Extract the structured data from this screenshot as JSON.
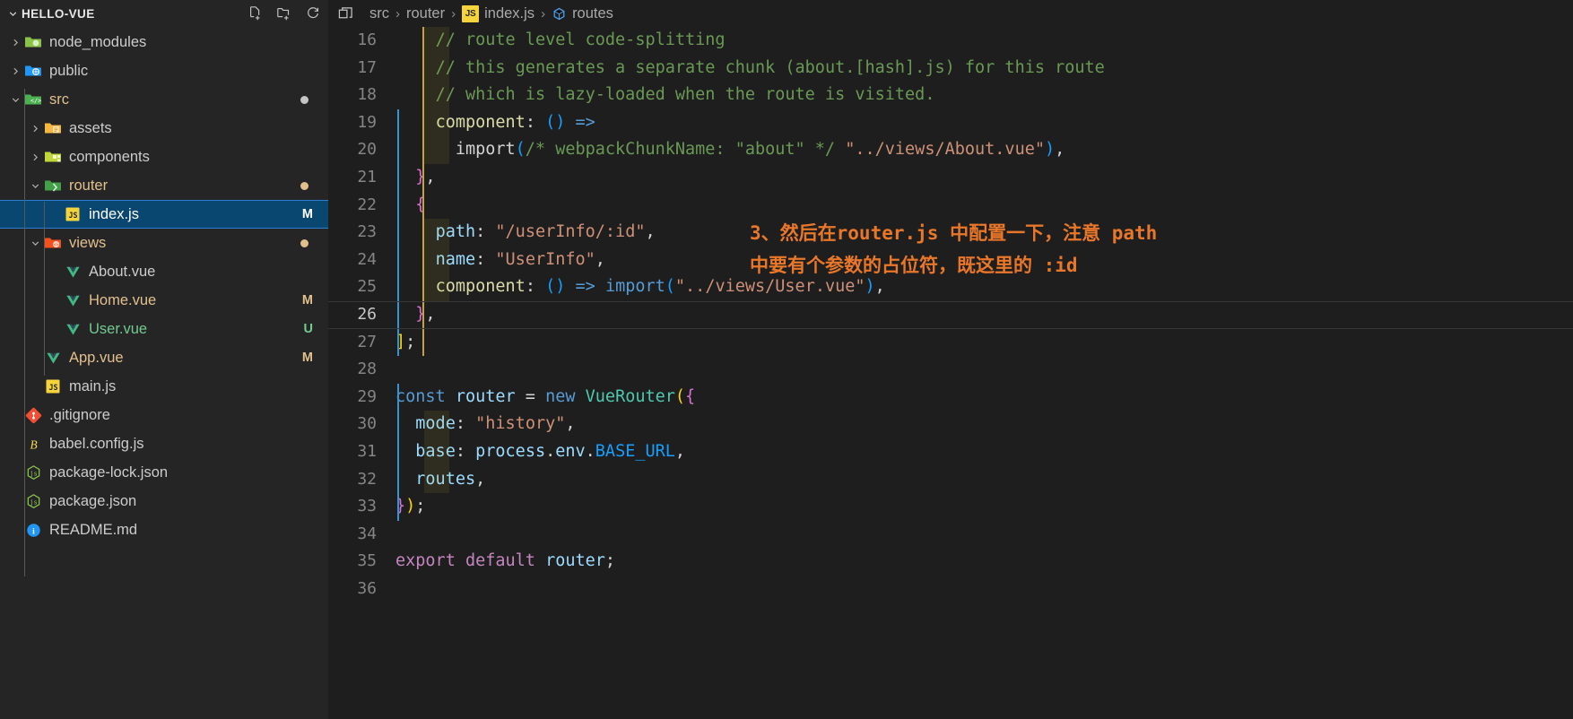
{
  "sidebar": {
    "title": "HELLO-VUE",
    "actions": [
      {
        "name": "new-file-icon",
        "label": "New File"
      },
      {
        "name": "new-folder-icon",
        "label": "New Folder"
      },
      {
        "name": "refresh-icon",
        "label": "Refresh Explorer"
      }
    ],
    "items": [
      {
        "label": "node_modules",
        "type": "folder",
        "icon": "folder-node-icon",
        "indent": 0,
        "expanded": false,
        "badge": "",
        "dot": "",
        "color": "plain"
      },
      {
        "label": "public",
        "type": "folder",
        "icon": "folder-public-icon",
        "indent": 0,
        "expanded": false,
        "badge": "",
        "dot": "",
        "color": "plain"
      },
      {
        "label": "src",
        "type": "folder",
        "icon": "folder-src-icon",
        "indent": 0,
        "expanded": true,
        "badge": "",
        "dot": "white",
        "color": "accent"
      },
      {
        "label": "assets",
        "type": "folder",
        "icon": "folder-assets-icon",
        "indent": 1,
        "expanded": false,
        "badge": "",
        "dot": "",
        "color": "plain"
      },
      {
        "label": "components",
        "type": "folder",
        "icon": "folder-components-icon",
        "indent": 1,
        "expanded": false,
        "badge": "",
        "dot": "",
        "color": "plain"
      },
      {
        "label": "router",
        "type": "folder",
        "icon": "folder-router-icon",
        "indent": 1,
        "expanded": true,
        "badge": "",
        "dot": "amber",
        "color": "accent"
      },
      {
        "label": "index.js",
        "type": "file",
        "icon": "js-file-icon",
        "indent": 2,
        "expanded": null,
        "badge": "M",
        "dot": "",
        "color": "plain",
        "selected": true
      },
      {
        "label": "views",
        "type": "folder",
        "icon": "folder-views-icon",
        "indent": 1,
        "expanded": true,
        "badge": "",
        "dot": "amber",
        "color": "accent"
      },
      {
        "label": "About.vue",
        "type": "file",
        "icon": "vue-file-icon",
        "indent": 2,
        "expanded": null,
        "badge": "",
        "dot": "",
        "color": "plain"
      },
      {
        "label": "Home.vue",
        "type": "file",
        "icon": "vue-file-icon",
        "indent": 2,
        "expanded": null,
        "badge": "M",
        "dot": "",
        "color": "accent"
      },
      {
        "label": "User.vue",
        "type": "file",
        "icon": "vue-file-icon",
        "indent": 2,
        "expanded": null,
        "badge": "U",
        "dot": "",
        "color": "green"
      },
      {
        "label": "App.vue",
        "type": "file",
        "icon": "vue-file-icon",
        "indent": 1,
        "expanded": null,
        "badge": "M",
        "dot": "",
        "color": "accent"
      },
      {
        "label": "main.js",
        "type": "file",
        "icon": "js-file-icon",
        "indent": 1,
        "expanded": null,
        "badge": "",
        "dot": "",
        "color": "plain"
      },
      {
        "label": ".gitignore",
        "type": "file",
        "icon": "git-file-icon",
        "indent": 0,
        "expanded": null,
        "badge": "",
        "dot": "",
        "color": "plain"
      },
      {
        "label": "babel.config.js",
        "type": "file",
        "icon": "babel-file-icon",
        "indent": 0,
        "expanded": null,
        "badge": "",
        "dot": "",
        "color": "plain"
      },
      {
        "label": "package-lock.json",
        "type": "file",
        "icon": "npm-file-icon",
        "indent": 0,
        "expanded": null,
        "badge": "",
        "dot": "",
        "color": "plain"
      },
      {
        "label": "package.json",
        "type": "file",
        "icon": "npm-file-icon",
        "indent": 0,
        "expanded": null,
        "badge": "",
        "dot": "",
        "color": "plain"
      },
      {
        "label": "README.md",
        "type": "file",
        "icon": "readme-file-icon",
        "indent": 0,
        "expanded": null,
        "badge": "",
        "dot": "",
        "color": "plain"
      }
    ]
  },
  "breadcrumb": {
    "split_icon": "split-editor-icon",
    "crumbs": [
      {
        "label": "src",
        "icon": ""
      },
      {
        "label": "router",
        "icon": ""
      },
      {
        "label": "index.js",
        "icon": "js-file-icon"
      },
      {
        "label": "routes",
        "icon": "symbol-variable-icon"
      }
    ],
    "separator": "›"
  },
  "editor": {
    "first_line": 16,
    "cursor_line": 26,
    "lines": [
      {
        "n": 16,
        "tokens": [
          {
            "t": "    ",
            "c": "t-pl"
          },
          {
            "t": "// route level code-splitting",
            "c": "t-com"
          }
        ]
      },
      {
        "n": 17,
        "tokens": [
          {
            "t": "    ",
            "c": "t-pl"
          },
          {
            "t": "// this generates a separate chunk (about.[hash].js) for this route",
            "c": "t-com"
          }
        ]
      },
      {
        "n": 18,
        "tokens": [
          {
            "t": "    ",
            "c": "t-pl"
          },
          {
            "t": "// which is lazy-loaded when the route is visited.",
            "c": "t-com"
          }
        ]
      },
      {
        "n": 19,
        "tokens": [
          {
            "t": "    ",
            "c": "t-pl"
          },
          {
            "t": "component",
            "c": "t-fn"
          },
          {
            "t": ": ",
            "c": "t-pl"
          },
          {
            "t": "()",
            "c": "t-br3"
          },
          {
            "t": " ",
            "c": "t-pl"
          },
          {
            "t": "=>",
            "c": "t-op"
          }
        ]
      },
      {
        "n": 20,
        "tokens": [
          {
            "t": "      ",
            "c": "t-pl"
          },
          {
            "t": "import",
            "c": "t-pl"
          },
          {
            "t": "(",
            "c": "t-br3"
          },
          {
            "t": "/* webpackChunkName: \"about\" */",
            "c": "t-com"
          },
          {
            "t": " ",
            "c": "t-pl"
          },
          {
            "t": "\"../views/About.vue\"",
            "c": "t-str"
          },
          {
            "t": ")",
            "c": "t-br3"
          },
          {
            "t": ",",
            "c": "t-pl"
          }
        ]
      },
      {
        "n": 21,
        "tokens": [
          {
            "t": "  ",
            "c": "t-pl"
          },
          {
            "t": "}",
            "c": "t-br2"
          },
          {
            "t": ",",
            "c": "t-pl"
          }
        ]
      },
      {
        "n": 22,
        "tokens": [
          {
            "t": "  ",
            "c": "t-pl"
          },
          {
            "t": "{",
            "c": "t-br2"
          }
        ]
      },
      {
        "n": 23,
        "tokens": [
          {
            "t": "    ",
            "c": "t-pl"
          },
          {
            "t": "path",
            "c": "t-prop"
          },
          {
            "t": ": ",
            "c": "t-pl"
          },
          {
            "t": "\"/userInfo/:id\"",
            "c": "t-str"
          },
          {
            "t": ",",
            "c": "t-pl"
          }
        ]
      },
      {
        "n": 24,
        "tokens": [
          {
            "t": "    ",
            "c": "t-pl"
          },
          {
            "t": "name",
            "c": "t-prop"
          },
          {
            "t": ": ",
            "c": "t-pl"
          },
          {
            "t": "\"UserInfo\"",
            "c": "t-str"
          },
          {
            "t": ",",
            "c": "t-pl"
          }
        ]
      },
      {
        "n": 25,
        "tokens": [
          {
            "t": "    ",
            "c": "t-pl"
          },
          {
            "t": "component",
            "c": "t-fn"
          },
          {
            "t": ": ",
            "c": "t-pl"
          },
          {
            "t": "()",
            "c": "t-br3"
          },
          {
            "t": " ",
            "c": "t-pl"
          },
          {
            "t": "=>",
            "c": "t-op"
          },
          {
            "t": " ",
            "c": "t-pl"
          },
          {
            "t": "import",
            "c": "t-key"
          },
          {
            "t": "(",
            "c": "t-br3"
          },
          {
            "t": "\"../views/User.vue\"",
            "c": "t-str"
          },
          {
            "t": ")",
            "c": "t-br3"
          },
          {
            "t": ",",
            "c": "t-pl"
          }
        ]
      },
      {
        "n": 26,
        "tokens": [
          {
            "t": "  ",
            "c": "t-pl"
          },
          {
            "t": "}",
            "c": "t-br2"
          },
          {
            "t": ",",
            "c": "t-pl"
          }
        ]
      },
      {
        "n": 27,
        "tokens": [
          {
            "t": "]",
            "c": "t-br1"
          },
          {
            "t": ";",
            "c": "t-pl"
          }
        ]
      },
      {
        "n": 28,
        "tokens": []
      },
      {
        "n": 29,
        "tokens": [
          {
            "t": "const",
            "c": "t-key"
          },
          {
            "t": " ",
            "c": "t-pl"
          },
          {
            "t": "router",
            "c": "t-prop"
          },
          {
            "t": " = ",
            "c": "t-pl"
          },
          {
            "t": "new",
            "c": "t-key"
          },
          {
            "t": " ",
            "c": "t-pl"
          },
          {
            "t": "VueRouter",
            "c": "t-cls"
          },
          {
            "t": "(",
            "c": "t-br1"
          },
          {
            "t": "{",
            "c": "t-br2"
          }
        ]
      },
      {
        "n": 30,
        "tokens": [
          {
            "t": "  ",
            "c": "t-pl"
          },
          {
            "t": "mode",
            "c": "t-prop"
          },
          {
            "t": ": ",
            "c": "t-pl"
          },
          {
            "t": "\"history\"",
            "c": "t-str"
          },
          {
            "t": ",",
            "c": "t-pl"
          }
        ]
      },
      {
        "n": 31,
        "tokens": [
          {
            "t": "  ",
            "c": "t-pl"
          },
          {
            "t": "base",
            "c": "t-prop"
          },
          {
            "t": ": ",
            "c": "t-pl"
          },
          {
            "t": "process",
            "c": "t-prop"
          },
          {
            "t": ".",
            "c": "t-pl"
          },
          {
            "t": "env",
            "c": "t-prop"
          },
          {
            "t": ".",
            "c": "t-pl"
          },
          {
            "t": "BASE_URL",
            "c": "t-br3"
          },
          {
            "t": ",",
            "c": "t-pl"
          }
        ]
      },
      {
        "n": 32,
        "tokens": [
          {
            "t": "  ",
            "c": "t-pl"
          },
          {
            "t": "routes",
            "c": "t-prop"
          },
          {
            "t": ",",
            "c": "t-pl"
          }
        ]
      },
      {
        "n": 33,
        "tokens": [
          {
            "t": "}",
            "c": "t-br2"
          },
          {
            "t": ")",
            "c": "t-br1"
          },
          {
            "t": ";",
            "c": "t-pl"
          }
        ]
      },
      {
        "n": 34,
        "tokens": []
      },
      {
        "n": 35,
        "tokens": [
          {
            "t": "export",
            "c": "t-kw2"
          },
          {
            "t": " ",
            "c": "t-pl"
          },
          {
            "t": "default",
            "c": "t-kw2"
          },
          {
            "t": " ",
            "c": "t-pl"
          },
          {
            "t": "router",
            "c": "t-prop"
          },
          {
            "t": ";",
            "c": "t-pl"
          }
        ]
      },
      {
        "n": 36,
        "tokens": []
      }
    ],
    "annotation": {
      "color": "#e8772a",
      "line1": "3、然后在router.js 中配置一下，注意 path",
      "line2": "中要有个参数的占位符，既这里的 :id"
    }
  }
}
